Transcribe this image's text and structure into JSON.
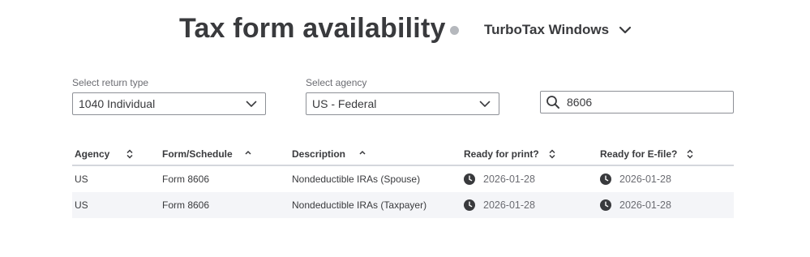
{
  "header": {
    "title": "Tax form availability",
    "product_selector": {
      "selected": "TurboTax Windows",
      "icon": "chevron-down-icon"
    }
  },
  "filters": {
    "return_type": {
      "label": "Select return type",
      "value": "1040 Individual"
    },
    "agency": {
      "label": "Select agency",
      "value": "US - Federal"
    },
    "search": {
      "value": "8606",
      "placeholder": "",
      "icon": "search-icon"
    }
  },
  "table": {
    "columns": [
      {
        "label": "Agency",
        "sort": "both"
      },
      {
        "label": "Form/Schedule",
        "sort": "ascending"
      },
      {
        "label": "Description",
        "sort": "ascending"
      },
      {
        "label": "Ready for print?",
        "sort": "both"
      },
      {
        "label": "Ready for E-file?",
        "sort": "both"
      }
    ],
    "rows": [
      {
        "agency": "US",
        "form": "Form 8606",
        "description": "Nondeductible IRAs (Spouse)",
        "print_date": "2026-01-28",
        "efile_date": "2026-01-28"
      },
      {
        "agency": "US",
        "form": "Form 8606",
        "description": "Nondeductible IRAs (Taxpayer)",
        "print_date": "2026-01-28",
        "efile_date": "2026-01-28"
      }
    ]
  },
  "colors": {
    "text": "#393a3d",
    "muted_text": "#6b6c72",
    "border": "#8d9096",
    "row_alt": "#f4f5f8",
    "dot": "#b5b8bd"
  }
}
